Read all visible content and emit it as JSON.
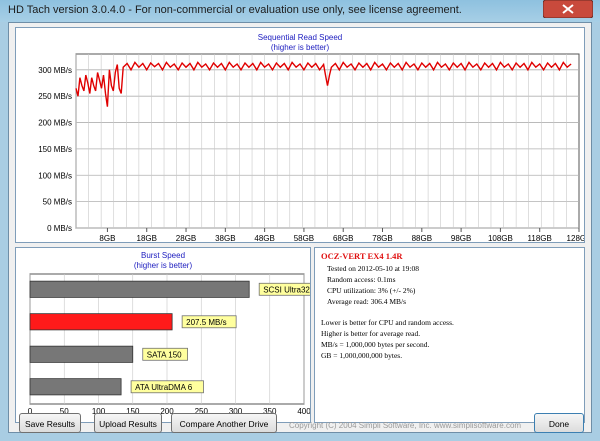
{
  "window": {
    "title": "HD Tach version 3.0.4.0  - For non-commercial or evaluation use only, see license agreement."
  },
  "sequential": {
    "title": "Sequential Read Speed",
    "subtitle": "(higher is better)"
  },
  "burst": {
    "title": "Burst Speed",
    "subtitle": "(higher is better)"
  },
  "info": {
    "drive": "OCZ-VERT EX4 1.4R",
    "lines": [
      "Tested on 2012-05-10 at 19:08",
      "Random access: 0.1ms",
      "CPU utilization: 3% (+/- 2%)",
      "Average read: 306.4 MB/s"
    ],
    "notes": [
      "Lower is better for CPU and random access.",
      "Higher is better for average read.",
      "MB/s = 1,000,000 bytes per second.",
      "GB = 1,000,000,000 bytes."
    ]
  },
  "buttons": {
    "save": "Save Results",
    "upload": "Upload Results",
    "compare": "Compare Another Drive",
    "done": "Done"
  },
  "copyright": "Copyright (C) 2004 Simpli Software, Inc. www.simplisoftware.com",
  "chart_data": [
    {
      "type": "line",
      "title": "Sequential Read Speed",
      "subtitle": "(higher is better)",
      "y_ticks": [
        "0 MB/s",
        "50 MB/s",
        "100 MB/s",
        "150 MB/s",
        "200 MB/s",
        "250 MB/s",
        "300 MB/s"
      ],
      "x_ticks": [
        "8GB",
        "18GB",
        "28GB",
        "38GB",
        "48GB",
        "58GB",
        "68GB",
        "78GB",
        "88GB",
        "98GB",
        "108GB",
        "118GB",
        "128GB"
      ],
      "ylim": [
        0,
        330
      ],
      "xlim": [
        0,
        128
      ],
      "grid": true,
      "series_color": "#e00000",
      "x": [
        0,
        0.5,
        1,
        1.5,
        2,
        2.5,
        3,
        3.5,
        4,
        4.5,
        5,
        5.5,
        6,
        6.5,
        7,
        7.5,
        8,
        8.5,
        9,
        9.5,
        10,
        10.5,
        11,
        11.5,
        12,
        13,
        14,
        15,
        16,
        17,
        18,
        19,
        20,
        21,
        22,
        23,
        24,
        25,
        26,
        27,
        28,
        29,
        30,
        31,
        32,
        33,
        34,
        35,
        36,
        37,
        38,
        39,
        40,
        41,
        42,
        43,
        44,
        45,
        46,
        47,
        48,
        49,
        50,
        51,
        52,
        53,
        54,
        55,
        56,
        57,
        58,
        59,
        60,
        61,
        62,
        63,
        63.5,
        64,
        64.5,
        65,
        66,
        67,
        68,
        69,
        70,
        71,
        72,
        73,
        74,
        75,
        76,
        77,
        78,
        79,
        80,
        81,
        82,
        83,
        84,
        85,
        86,
        87,
        88,
        89,
        90,
        91,
        92,
        93,
        94,
        95,
        96,
        97,
        98,
        99,
        100,
        101,
        102,
        103,
        104,
        105,
        106,
        107,
        108,
        109,
        110,
        111,
        112,
        113,
        114,
        115,
        116,
        117,
        118,
        119,
        120,
        121,
        122,
        123,
        124,
        125,
        126,
        127,
        128
      ],
      "values": [
        265,
        250,
        285,
        270,
        260,
        290,
        275,
        255,
        285,
        270,
        260,
        295,
        280,
        265,
        290,
        255,
        230,
        300,
        270,
        260,
        295,
        310,
        265,
        255,
        305,
        312,
        300,
        314,
        305,
        312,
        300,
        313,
        306,
        312,
        300,
        314,
        305,
        311,
        300,
        313,
        305,
        312,
        300,
        314,
        305,
        311,
        300,
        313,
        305,
        312,
        300,
        314,
        305,
        311,
        300,
        313,
        305,
        312,
        300,
        314,
        305,
        311,
        300,
        313,
        305,
        312,
        300,
        314,
        305,
        311,
        300,
        313,
        305,
        312,
        300,
        310,
        290,
        270,
        290,
        305,
        312,
        300,
        314,
        305,
        311,
        300,
        313,
        305,
        312,
        300,
        314,
        305,
        311,
        300,
        313,
        305,
        312,
        300,
        314,
        305,
        311,
        300,
        313,
        305,
        312,
        300,
        314,
        305,
        311,
        300,
        313,
        305,
        312,
        300,
        314,
        305,
        311,
        300,
        313,
        305,
        312,
        300,
        314,
        305,
        311,
        300,
        313,
        305,
        312,
        300,
        314,
        305,
        311,
        300,
        313,
        305,
        312,
        300,
        314,
        305,
        311
      ]
    },
    {
      "type": "bar",
      "title": "Burst Speed",
      "subtitle": "(higher is better)",
      "orientation": "horizontal",
      "categories": [
        "SCSI Ultra320",
        "207.5 MB/s",
        "SATA 150",
        "ATA UltraDMA 6"
      ],
      "values": [
        320,
        207.5,
        150,
        133
      ],
      "colors": [
        "#777777",
        "#ff1a1a",
        "#777777",
        "#777777"
      ],
      "x_ticks": [
        "0",
        "50",
        "100",
        "150",
        "200",
        "250",
        "300",
        "350",
        "400"
      ],
      "xlim": [
        0,
        400
      ],
      "grid": true
    }
  ]
}
